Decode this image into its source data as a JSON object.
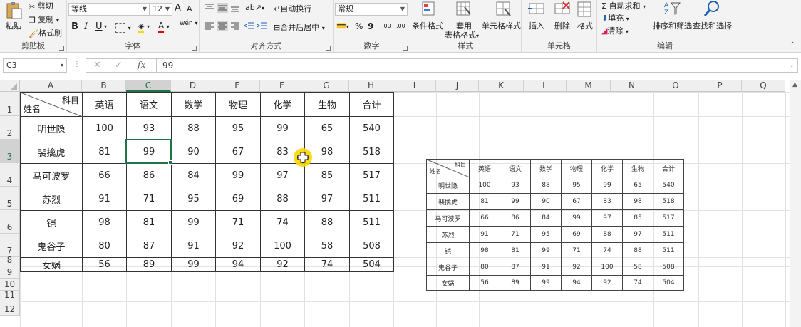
{
  "ribbon": {
    "clipboard": {
      "label": "剪贴板",
      "paste": "粘贴",
      "cut": "剪切",
      "copy": "复制",
      "format_painter": "格式刷"
    },
    "font": {
      "label": "字体",
      "font_name": "等线",
      "font_size": "12",
      "bold": "B",
      "italic": "I",
      "underline": "U",
      "grow": "A",
      "shrink": "A",
      "phonetic": "wén"
    },
    "alignment": {
      "label": "对齐方式",
      "wrap_text": "自动换行",
      "merge_center": "合并后居中"
    },
    "number": {
      "label": "数字",
      "format": "常规",
      "percent": "%",
      "comma": "9",
      "inc_decimal": ".00",
      "dec_decimal": ".00"
    },
    "styles": {
      "label": "样式",
      "conditional": "条件格式",
      "table_format_1": "套用",
      "table_format_2": "表格格式",
      "cell_styles": "单元格样式"
    },
    "cells": {
      "label": "单元格",
      "insert": "插入",
      "delete": "删除",
      "format": "格式"
    },
    "editing": {
      "label": "编辑",
      "autosum": "自动求和",
      "fill": "填充",
      "clear": "清除",
      "sort_filter": "排序和筛选",
      "find_select": "查找和选择"
    }
  },
  "formula_bar": {
    "name_box": "C3",
    "fx": "fx",
    "value": "99"
  },
  "columns": [
    "A",
    "B",
    "C",
    "D",
    "E",
    "F",
    "G",
    "H",
    "I",
    "J",
    "K",
    "L",
    "M",
    "N",
    "O",
    "P",
    "Q"
  ],
  "rows": [
    "1",
    "2",
    "3",
    "4",
    "5",
    "6",
    "7",
    "8",
    "9",
    "10",
    "11",
    "12"
  ],
  "table": {
    "corner_top": "科目",
    "corner_bottom": "姓名",
    "headers": [
      "英语",
      "语文",
      "数学",
      "物理",
      "化学",
      "生物",
      "合计"
    ],
    "rows": [
      {
        "name": "明世隐",
        "values": [
          "100",
          "93",
          "88",
          "95",
          "99",
          "65",
          "540"
        ]
      },
      {
        "name": "裴擒虎",
        "values": [
          "81",
          "99",
          "90",
          "67",
          "83",
          "98",
          "518"
        ]
      },
      {
        "name": "马可波罗",
        "values": [
          "66",
          "86",
          "84",
          "99",
          "97",
          "85",
          "517"
        ]
      },
      {
        "name": "苏烈",
        "values": [
          "91",
          "71",
          "95",
          "69",
          "88",
          "97",
          "511"
        ]
      },
      {
        "name": "铠",
        "values": [
          "98",
          "81",
          "99",
          "71",
          "74",
          "88",
          "511"
        ]
      },
      {
        "name": "鬼谷子",
        "values": [
          "80",
          "87",
          "91",
          "92",
          "100",
          "58",
          "508"
        ]
      },
      {
        "name": "女娲",
        "values": [
          "56",
          "89",
          "99",
          "94",
          "92",
          "74",
          "504"
        ]
      }
    ]
  },
  "colors": {
    "accent": "#217346",
    "cursor": "#FFD600"
  }
}
